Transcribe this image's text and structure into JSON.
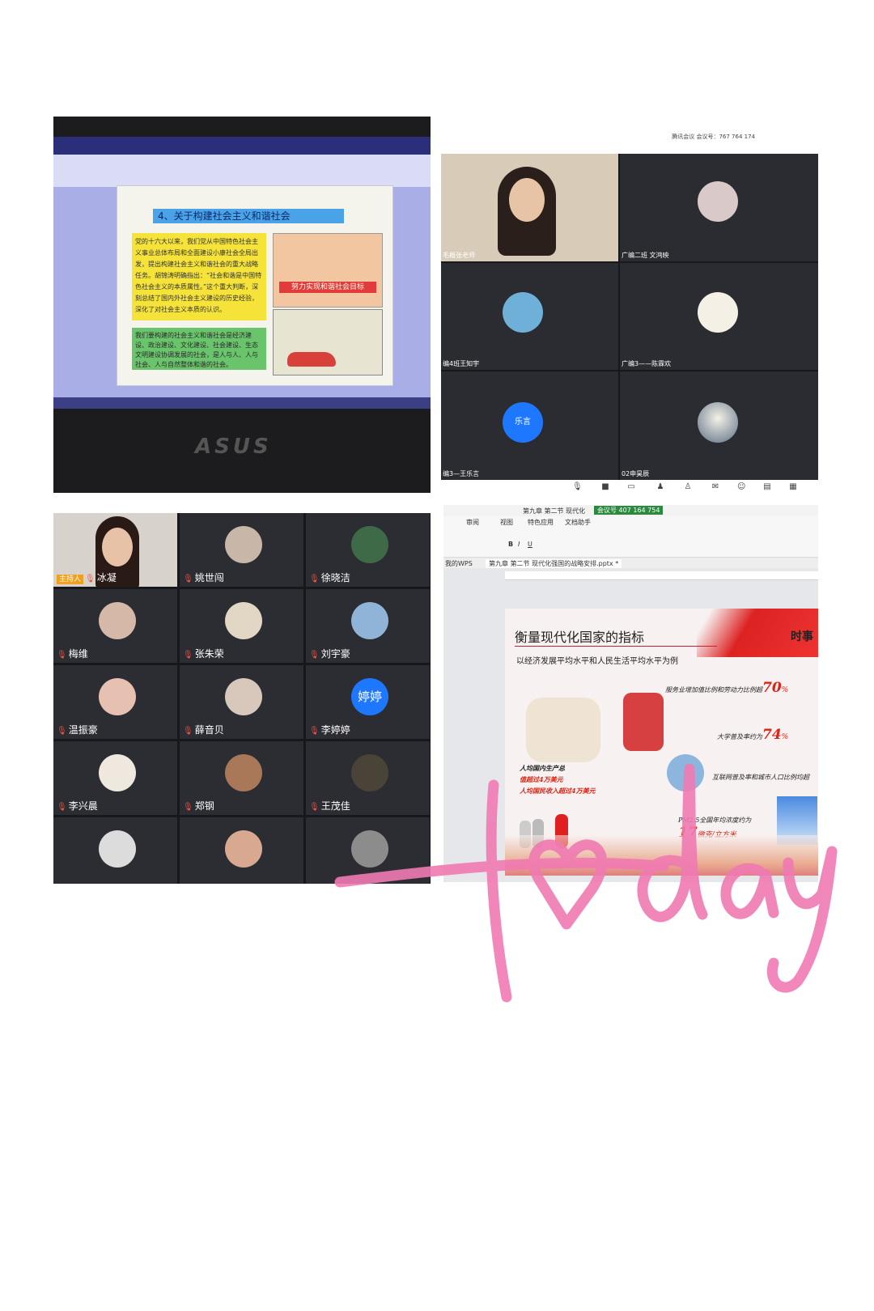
{
  "panel1": {
    "slide_title": "4、关于构建社会主义和谐社会",
    "yellow_text": "党的十六大以来，我们党从中国特色社会主义事业总体布局和全面建设小康社会全局出发，提出构建社会主义和谐社会的重大战略任务。胡锦涛明确指出：“社会和谐是中国特色社会主义的本质属性。”这个重大判断，深刻总结了国内外社会主义建设的历史经验，深化了对社会主义本质的认识。",
    "green_text": "我们要构建的社会主义和谐社会是经济建设、政治建设、文化建设、社会建设、生态文明建设协调发展的社会，是人与人、人与社会、人与自然整体和谐的社会。",
    "banner": "努力实现和谐社会目标",
    "laptop_brand": "ASUS"
  },
  "panel2": {
    "meeting_id": "腾讯会议 会议号：767 764 174",
    "participants": [
      {
        "name": "毛概张老师"
      },
      {
        "name": "广编二班 文鸿映"
      },
      {
        "name": "编4班王知宇"
      },
      {
        "name": "广编3——陈霖欢"
      },
      {
        "name": "编3—王乐言",
        "initials": "乐言"
      },
      {
        "name": "02申昊辰"
      }
    ]
  },
  "panel3": {
    "host_badge": "主持人",
    "participants": [
      {
        "name": "冰凝"
      },
      {
        "name": "姚世闯"
      },
      {
        "name": "徐晓洁"
      },
      {
        "name": "梅维"
      },
      {
        "name": "张朱荣"
      },
      {
        "name": "刘宇豪"
      },
      {
        "name": "温振豪"
      },
      {
        "name": "薛音贝"
      },
      {
        "name": "李婷婷",
        "initials": "婷婷"
      },
      {
        "name": "李兴晨"
      },
      {
        "name": "郑钢"
      },
      {
        "name": "王茂佳"
      },
      {
        "name": ""
      },
      {
        "name": ""
      },
      {
        "name": ""
      }
    ]
  },
  "panel4": {
    "window_title": "第九章 第二节 现代化",
    "meeting_overlay": "会议号 407 164 754",
    "ribbon_tabs": [
      "审阅",
      "视图",
      "特色应用",
      "文档助手"
    ],
    "doc_tabs": [
      "我的WPS",
      "第九章 第二节 现代化强国的战略安排.pptx *"
    ],
    "slide": {
      "title": "衡量现代化国家的指标",
      "subtitle": "以经济发展平均水平和人民生活平均水平为例",
      "logo": "时事",
      "stats": [
        {
          "label": "服务业增加值比例和劳动力比例超",
          "value": "70",
          "unit": "%"
        },
        {
          "label": "大学普及率约为",
          "value": "74",
          "unit": "%"
        },
        {
          "label": "互联网普及率和城市人口比例均超",
          "value": "",
          "unit": ""
        },
        {
          "label": "PM2.5全国年均浓度约为",
          "value": "17",
          "unit": "微克/立方米"
        }
      ],
      "gdp_text": [
        "人均国内生产总",
        "值超过4万美元",
        "人均国民收入超过4万美元"
      ]
    }
  },
  "handwriting": "today",
  "colors": {
    "handwriting": "#f07ab2",
    "zoom_blue": "#1e78ff",
    "alert_red": "#d21"
  }
}
